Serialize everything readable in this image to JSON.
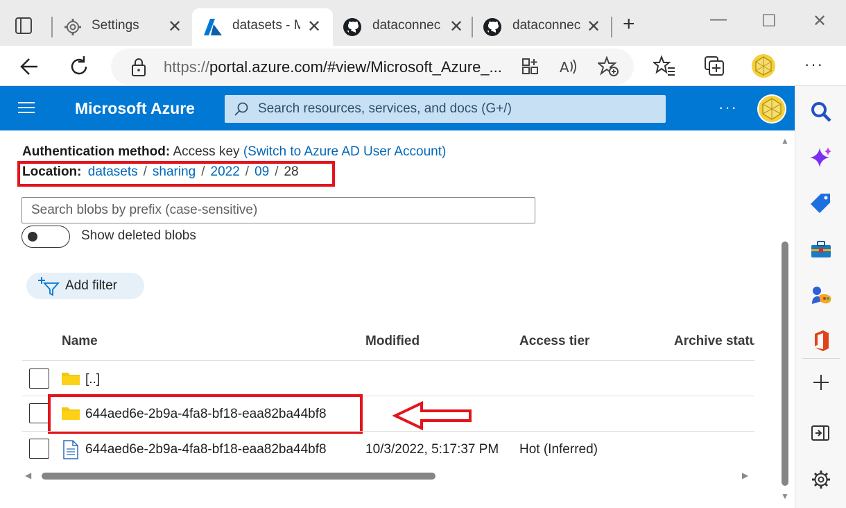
{
  "browser": {
    "tabs": [
      {
        "title": "Settings",
        "active": false
      },
      {
        "title": "datasets - Microsoft Azure",
        "active": true
      },
      {
        "title": "dataconnectors",
        "active": false
      },
      {
        "title": "dataconnectors",
        "active": false
      }
    ],
    "close_glyph": "✕",
    "new_tab_glyph": "+",
    "window_controls": {
      "minimize": "—",
      "maximize": "☐",
      "close": "✕"
    },
    "address": {
      "protocol": "https://",
      "rest": "portal.azure.com/#view/Microsoft_Azure_..."
    },
    "more_glyph": "···"
  },
  "azure": {
    "brand": "Microsoft Azure",
    "search_placeholder": "Search resources, services, and docs (G+/)",
    "more_glyph": "···",
    "accent": "#0078d4"
  },
  "blade": {
    "auth_label": "Authentication method:",
    "auth_value": "Access key",
    "auth_link": "(Switch to Azure AD User Account)",
    "location_label": "Location:",
    "breadcrumb": [
      "datasets",
      "sharing",
      "2022",
      "09",
      "28"
    ],
    "breadcrumb_sep": "/",
    "blob_search_placeholder": "Search blobs by prefix (case-sensitive)",
    "toggle_label": "Show deleted blobs",
    "toggle_on": false,
    "add_filter_label": "Add filter",
    "columns": [
      "Name",
      "Modified",
      "Access tier",
      "Archive statu"
    ],
    "rows": [
      {
        "type": "folder",
        "name": "[..]",
        "modified": "",
        "tier": ""
      },
      {
        "type": "folder",
        "name": "644aed6e-2b9a-4fa8-bf18-eaa82ba44bf8",
        "modified": "",
        "tier": ""
      },
      {
        "type": "file",
        "name": "644aed6e-2b9a-4fa8-bf18-eaa82ba44bf8",
        "modified": "10/3/2022, 5:17:37 PM",
        "tier": "Hot (Inferred)"
      }
    ],
    "highlight_color": "#e3141c"
  }
}
